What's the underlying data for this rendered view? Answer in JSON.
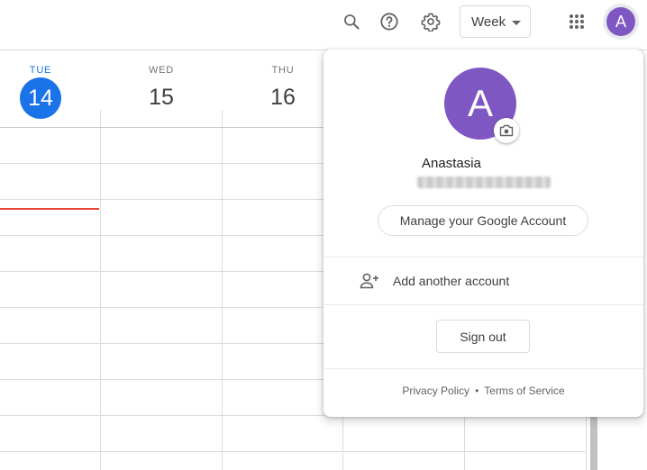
{
  "header": {
    "view_label": "Week",
    "account_initial": "A",
    "icons": [
      "search-icon",
      "help-icon",
      "settings-icon",
      "apps-grid-icon"
    ]
  },
  "calendar": {
    "days": [
      {
        "dow": "TUE",
        "num": "14",
        "today": true
      },
      {
        "dow": "WED",
        "num": "15",
        "today": false
      },
      {
        "dow": "THU",
        "num": "16",
        "today": false
      }
    ],
    "colors": {
      "today": "#1a73e8",
      "now_line": "#ea4335"
    }
  },
  "account_popup": {
    "initial": "A",
    "name": "Anastasia",
    "manage_label": "Manage your Google Account",
    "add_account_label": "Add another account",
    "sign_out_label": "Sign out",
    "privacy_label": "Privacy Policy",
    "separator": "•",
    "terms_label": "Terms of Service",
    "avatar_color": "#7e57c2"
  }
}
